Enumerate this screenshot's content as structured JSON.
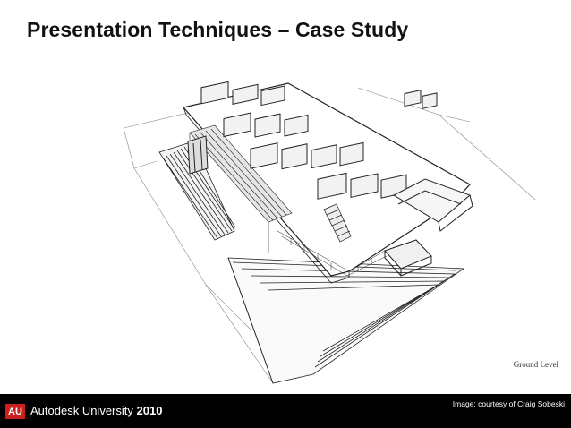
{
  "slide": {
    "title": "Presentation Techniques – Case Study",
    "drawing_label": "Ground Level"
  },
  "footer": {
    "logo_text": "AU",
    "brand_name": "Autodesk University",
    "brand_year": "2010",
    "credit": "Image: courtesy of Craig Sobeski",
    "logo_color": "#cc1f1f",
    "background": "#000000"
  }
}
